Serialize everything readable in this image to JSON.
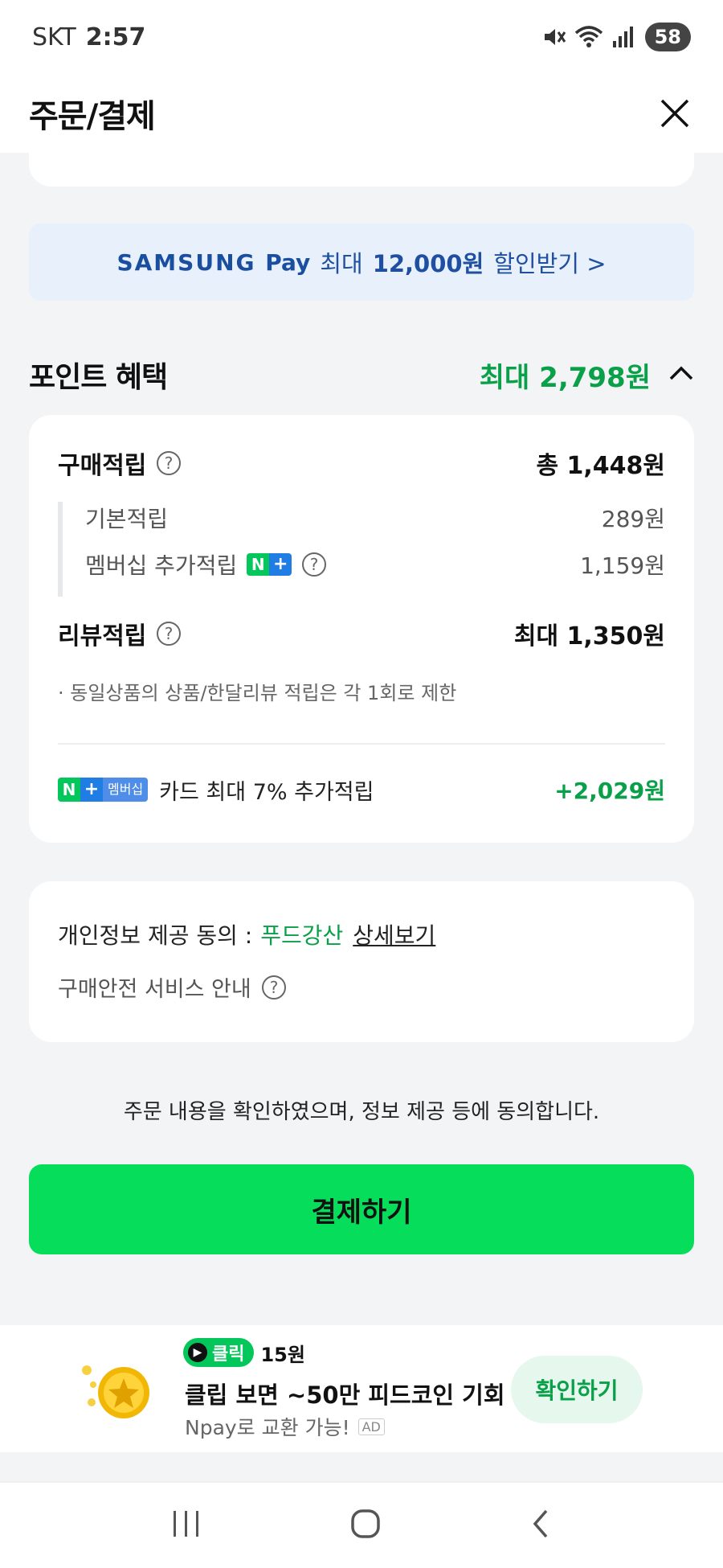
{
  "status_bar": {
    "carrier": "SKT",
    "time": "2:57",
    "battery": "58"
  },
  "header": {
    "title": "주문/결제"
  },
  "samsung_banner": {
    "brand": "SAMSUNG",
    "pay": "Pay",
    "text": "최대",
    "amount": "12,000원",
    "suffix": "할인받기 >"
  },
  "points_section": {
    "title": "포인트 혜택",
    "max_label": "최대 2,798원",
    "purchase": {
      "label": "구매적립",
      "value": "총 1,448원"
    },
    "basic": {
      "label": "기본적립",
      "value": "289원"
    },
    "membership": {
      "label": "멤버십 추가적립",
      "value": "1,159원"
    },
    "review": {
      "label": "리뷰적립",
      "value": "최대 1,350원"
    },
    "review_note": "· 동일상품의 상품/한달리뷰 적립은 각 1회로 제한",
    "card_badge": {
      "n": "N",
      "plus": "+",
      "mem": "멤버십"
    },
    "card": {
      "label": "카드 최대 7% 추가적립",
      "value": "+2,029원"
    }
  },
  "consent": {
    "label": "개인정보 제공 동의 :",
    "seller": "푸드강산",
    "detail": "상세보기",
    "safety": "구매안전 서비스 안내"
  },
  "agree_text": "주문 내용을 확인하였으며, 정보 제공 등에 동의합니다.",
  "pay_button": "결제하기",
  "ad": {
    "pill": "클릭",
    "reward": "15원",
    "title": "클립 보면 ~50만 피드코인 기회",
    "subtitle": "Npay로 교환 가능!",
    "ad_label": "AD",
    "button": "확인하기"
  },
  "colors": {
    "accent_green": "#06de5b",
    "point_green": "#0aa04a",
    "samsung_blue": "#1a4fa0"
  }
}
